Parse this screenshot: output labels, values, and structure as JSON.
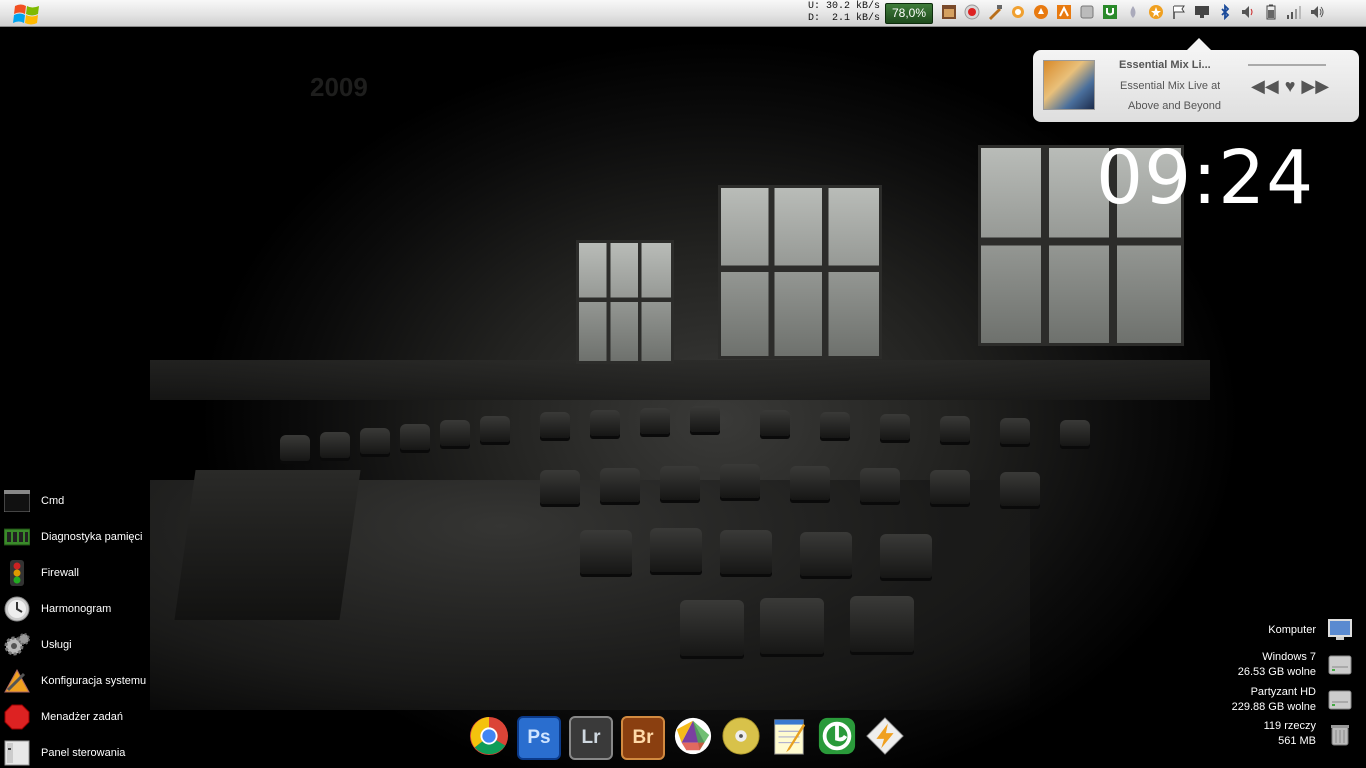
{
  "topbar": {
    "net_upload_label": "U:",
    "net_upload_value": "30.2 kB/s",
    "net_download_label": "D:",
    "net_download_value": "2.1 kB/s",
    "battery_percent": "78,0%"
  },
  "tray_icons": [
    "photo-app-icon",
    "record-icon",
    "tools-icon",
    "chat-icon",
    "avast-icon",
    "gmail-notifier-icon",
    "window-icon",
    "utorrent-icon",
    "drop-icon",
    "star-icon",
    "flag-icon",
    "network-icon",
    "bluetooth-icon",
    "volume-icon",
    "battery-icon",
    "signal-icon",
    "speaker-icon"
  ],
  "music": {
    "title": "Essential Mix Li...",
    "subtitle": "Essential Mix Live at",
    "artist": "Above and Beyond",
    "prev_label": "◀◀",
    "love_label": "♥",
    "next_label": "▶▶"
  },
  "clock": {
    "time": "09:24"
  },
  "shortcuts": [
    {
      "label": "Cmd",
      "icon": "cmd-icon"
    },
    {
      "label": "Diagnostyka pamięci",
      "icon": "memory-icon"
    },
    {
      "label": "Firewall",
      "icon": "firewall-icon"
    },
    {
      "label": "Harmonogram",
      "icon": "schedule-icon"
    },
    {
      "label": "Usługi",
      "icon": "gears-icon"
    },
    {
      "label": "Konfiguracja systemu",
      "icon": "config-icon"
    },
    {
      "label": "Menadżer zadań",
      "icon": "task-manager-icon"
    },
    {
      "label": "Panel sterowania",
      "icon": "control-panel-icon"
    }
  ],
  "dock": [
    {
      "name": "chrome",
      "label": ""
    },
    {
      "name": "photoshop",
      "label": "Ps"
    },
    {
      "name": "lightroom",
      "label": "Lr"
    },
    {
      "name": "bridge",
      "label": "Br"
    },
    {
      "name": "picasa",
      "label": ""
    },
    {
      "name": "dvd",
      "label": ""
    },
    {
      "name": "notepad",
      "label": ""
    },
    {
      "name": "utorrent",
      "label": ""
    },
    {
      "name": "winamp",
      "label": ""
    }
  ],
  "drives": {
    "computer": {
      "label": "Komputer"
    },
    "windows": {
      "line1": "Windows 7",
      "line2": "26.53 GB wolne"
    },
    "hd": {
      "line1": "Partyzant HD",
      "line2": "229.88 GB wolne"
    },
    "trash": {
      "line1": "119 rzeczy",
      "line2": "561 MB"
    }
  },
  "wallpaper": {
    "year_text": "2009"
  }
}
